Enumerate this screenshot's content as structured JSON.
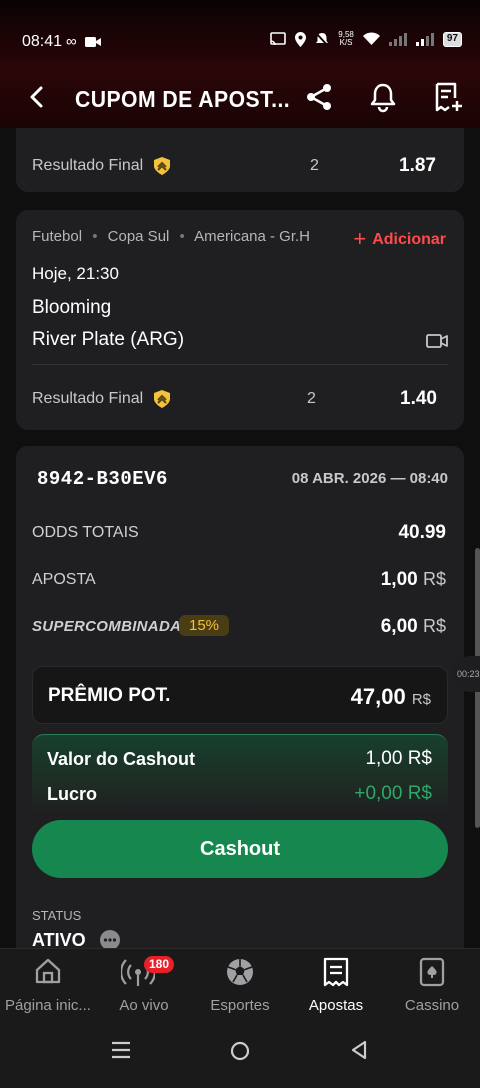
{
  "status": {
    "time": "08:41",
    "speed_top": "9,58",
    "speed_bottom": "K/S",
    "battery": "97"
  },
  "header": {
    "title": "CUPOM DE APOST..."
  },
  "bet1": {
    "market": "Resultado Final",
    "pick": "2",
    "odd": "1.87"
  },
  "bet2": {
    "breadcrumb": [
      "Futebol",
      "Copa Sul",
      "Americana - Gr.H"
    ],
    "add_label": "Adicionar",
    "time": "Hoje, 21:30",
    "home": "Blooming",
    "away": "River Plate (ARG)",
    "market": "Resultado Final",
    "pick": "2",
    "odd": "1.40"
  },
  "summary": {
    "code": "8942-B30EV6",
    "datetime": "08 ABR. 2026 — 08:40",
    "odds_label": "ODDS TOTAIS",
    "odds_value": "40.99",
    "stake_label": "APOSTA",
    "stake_value": "1,00",
    "currency": "R$",
    "supercombinada_label": "SUPERCOMBINADA",
    "supercombinada_pct": "15%",
    "supercombinada_value": "6,00",
    "premio_label": "PRÊMIO POT.",
    "premio_value": "47,00",
    "cashout_label": "Valor do Cashout",
    "cashout_value": "1,00",
    "lucro_label": "Lucro",
    "lucro_value": "+0,00",
    "cashout_button": "Cashout",
    "status_label": "STATUS",
    "status_value": "ATIVO"
  },
  "side_timer": "00:23",
  "nav": {
    "items": [
      {
        "label": "Página inic..."
      },
      {
        "label": "Ao vivo",
        "badge": "180"
      },
      {
        "label": "Esportes"
      },
      {
        "label": "Apostas"
      },
      {
        "label": "Cassino"
      }
    ]
  },
  "colors": {
    "accent_red": "#ff4a4a",
    "cashout_green": "#16874f",
    "profit_green": "#2ea86a",
    "badge_gold": "#f3c23a"
  }
}
